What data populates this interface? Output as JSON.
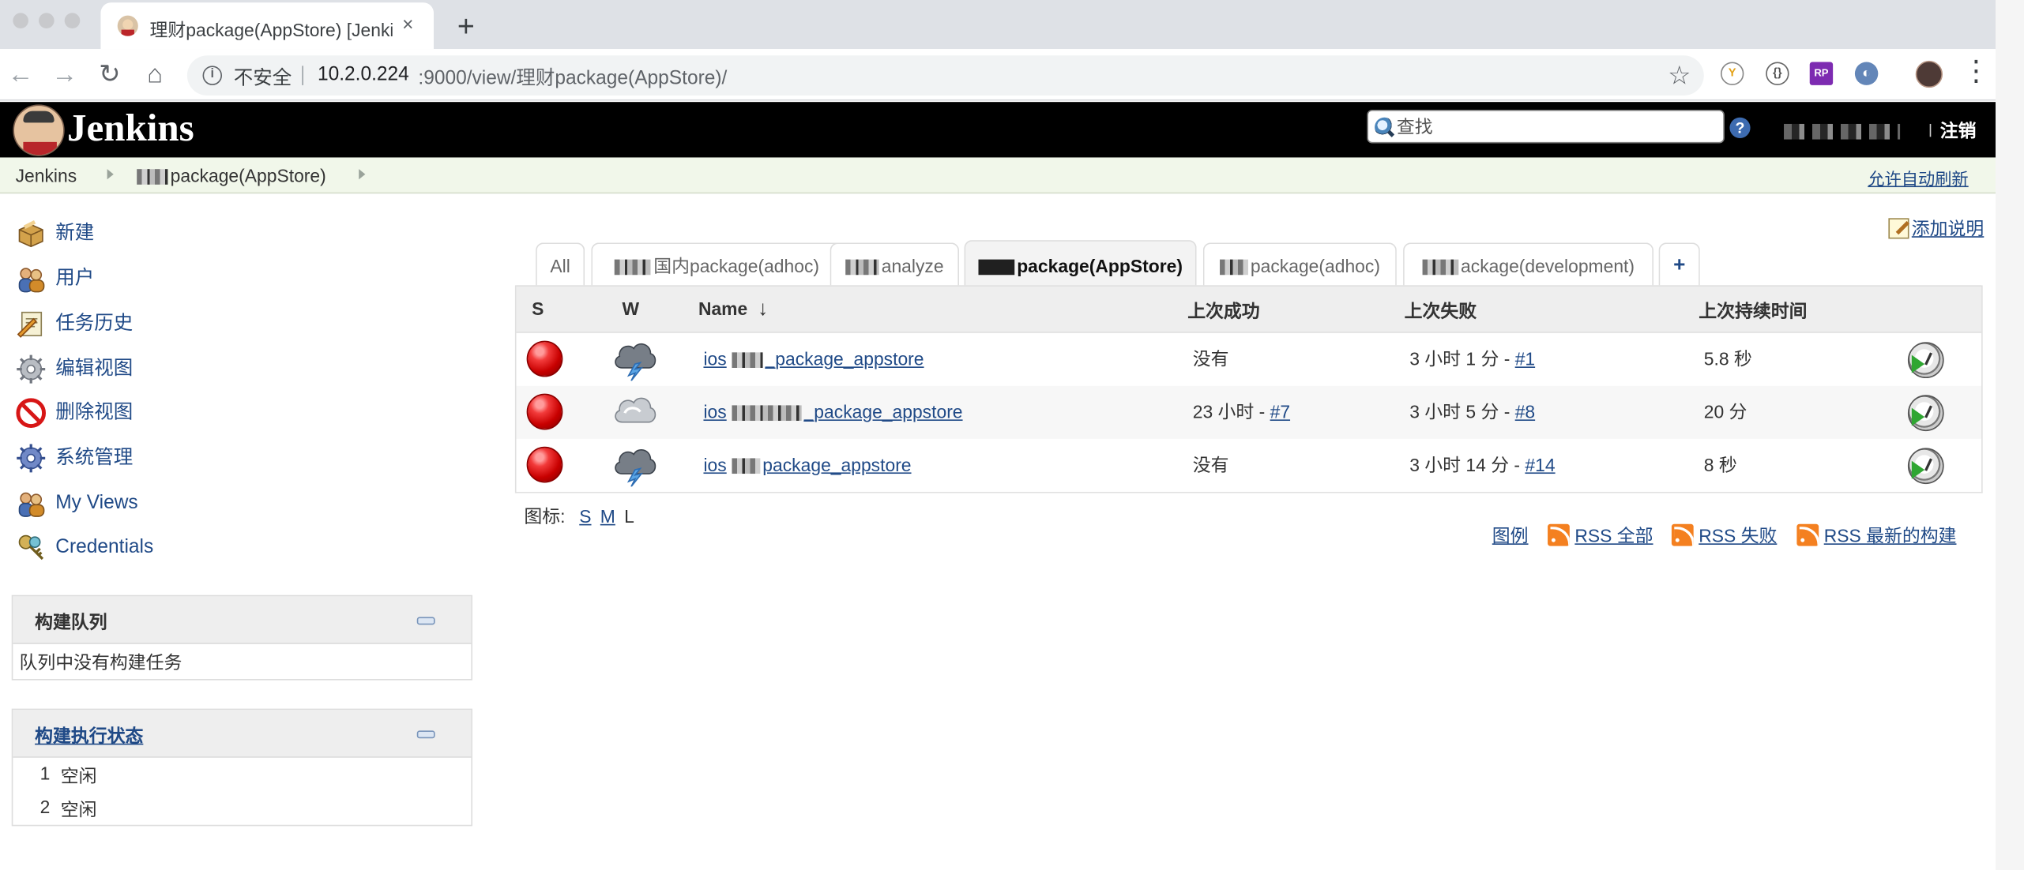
{
  "browser": {
    "tab_title": "理财package(AppStore) [Jenkins]",
    "new_tab": "+",
    "close": "×",
    "address": {
      "security": "不安全",
      "host": "10.2.0.224",
      "path": ":9000/view/理财package(AppStore)/"
    },
    "extensions": [
      "RP"
    ]
  },
  "jenkins": {
    "logo_text": "Jenkins",
    "search_placeholder": "查找",
    "help": "?",
    "logout": "注销",
    "breadcrumb": [
      {
        "label": "Jenkins"
      },
      {
        "label": "package(AppStore)"
      }
    ],
    "auto_refresh": "允许自动刷新"
  },
  "sidebar": {
    "tasks": [
      {
        "label": "新建",
        "icon": "new-package-icon"
      },
      {
        "label": "用户",
        "icon": "users-icon"
      },
      {
        "label": "任务历史",
        "icon": "notepad-icon"
      },
      {
        "label": "编辑视图",
        "icon": "gear-icon"
      },
      {
        "label": "删除视图",
        "icon": "no-entry-icon"
      },
      {
        "label": "系统管理",
        "icon": "settings-icon"
      },
      {
        "label": "My Views",
        "icon": "users-icon"
      },
      {
        "label": "Credentials",
        "icon": "key-icon"
      }
    ],
    "build_queue": {
      "title": "构建队列",
      "empty": "队列中没有构建任务"
    },
    "executors": {
      "title": "构建执行状态",
      "items": [
        {
          "number": "1",
          "status": "空闲"
        },
        {
          "number": "2",
          "status": "空闲"
        }
      ]
    }
  },
  "main": {
    "add_description": "添加说明",
    "tabs": [
      {
        "label": "All"
      },
      {
        "label": "国内package(adhoc)"
      },
      {
        "label": "analyze"
      },
      {
        "label": "package(AppStore)"
      },
      {
        "label": "package(adhoc)"
      },
      {
        "label": "ackage(development)"
      },
      {
        "label": "+"
      }
    ],
    "table": {
      "headers": {
        "status": "S",
        "weather": "W",
        "name": "Name",
        "sort": "↓",
        "last_success": "上次成功",
        "last_failure": "上次失败",
        "last_duration": "上次持续时间"
      },
      "rows": [
        {
          "name_prefix": "ios",
          "name_suffix": "_package_appstore",
          "last_success": "没有",
          "last_failure_text": "3 小时 1 分 -",
          "last_failure_link": "#1",
          "duration": "5.8 秒",
          "status_color": "#d40000",
          "weather": "thunderstorm-icon"
        },
        {
          "name_prefix": "ios",
          "name_suffix": "_package_appstore",
          "last_success_text": "23 小时 -",
          "last_success_link": "#7",
          "last_failure_text": "3 小时 5 分 -",
          "last_failure_link": "#8",
          "duration": "20 分",
          "status_color": "#d40000",
          "weather": "cloudy-icon"
        },
        {
          "name_prefix": "ios",
          "name_suffix": "package_appstore",
          "last_success": "没有",
          "last_failure_text": "3 小时 14 分 -",
          "last_failure_link": "#14",
          "duration": "8 秒",
          "status_color": "#d40000",
          "weather": "thunderstorm-icon"
        }
      ]
    },
    "icon_size": {
      "label": "图标:",
      "s": "S",
      "m": "M",
      "l": "L"
    },
    "rss": {
      "legend": "图例",
      "all": "RSS 全部",
      "failures": "RSS 失败",
      "latest": "RSS 最新的构建"
    }
  }
}
